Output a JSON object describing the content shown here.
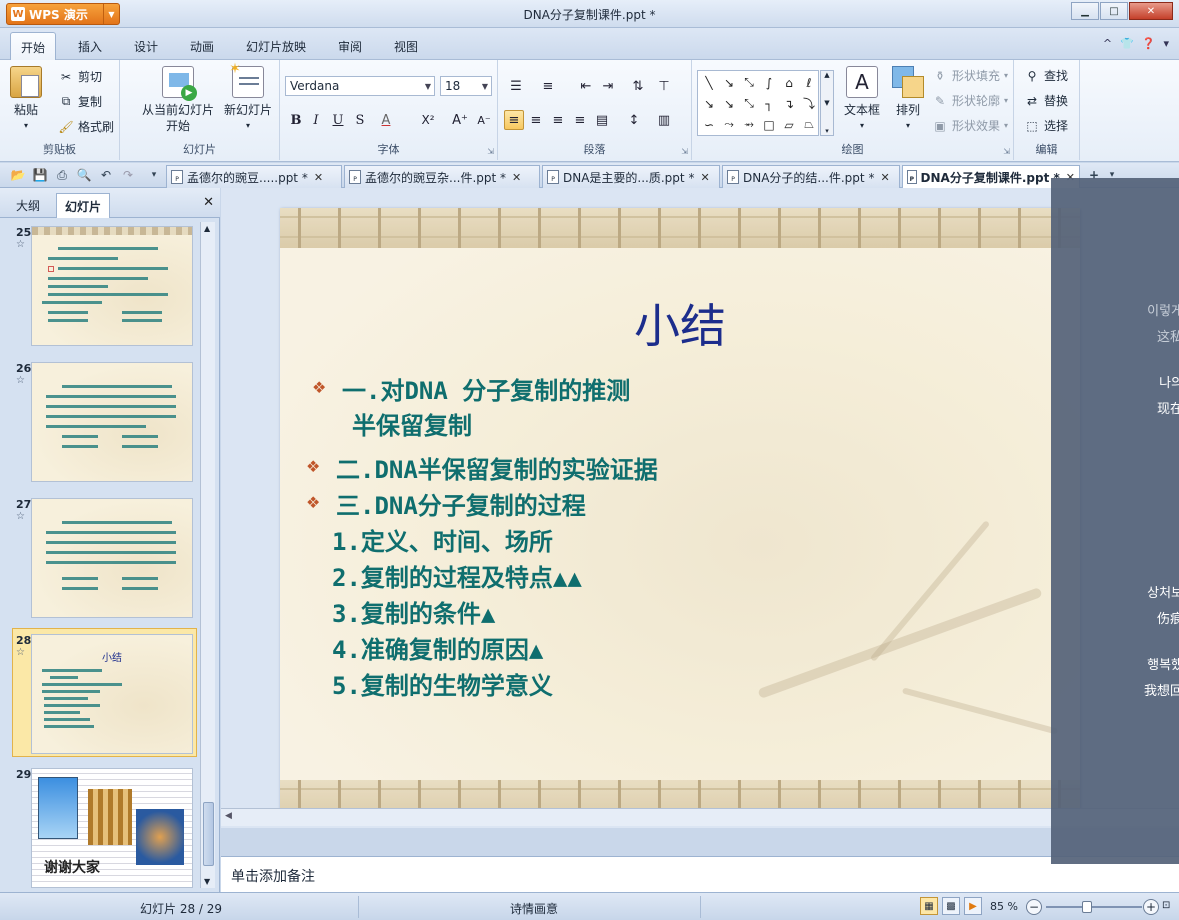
{
  "app": {
    "brand": "WPS 演示",
    "brand_logo": "W",
    "document_title": "DNA分子复制课件.ppt *"
  },
  "window_controls": {
    "minimize": "▁",
    "maximize": "□",
    "close": "✕"
  },
  "menu": {
    "tabs": [
      "开始",
      "插入",
      "设计",
      "动画",
      "幻灯片放映",
      "审阅",
      "视图"
    ],
    "active": "开始",
    "right_icons": [
      "^",
      "shirt-icon",
      "help-icon",
      "▾"
    ]
  },
  "ribbon": {
    "clipboard": {
      "label": "剪贴板",
      "paste": "粘贴",
      "cut": "剪切",
      "copy": "复制",
      "format_painter": "格式刷"
    },
    "slides": {
      "label": "幻灯片",
      "from_current_line1": "从当前幻灯片",
      "from_current_line2": "开始",
      "new_slide": "新幻灯片"
    },
    "font": {
      "label": "字体",
      "font_name": "Verdana",
      "font_size": "18",
      "bold": "B",
      "italic": "I",
      "underline": "U",
      "shadow": "S",
      "font_color": "A",
      "superscript": "X²",
      "grow": "A⁺",
      "shrink": "A⁻"
    },
    "paragraph": {
      "label": "段落"
    },
    "drawing": {
      "label": "绘图",
      "text_box": "文本框",
      "arrange": "排列",
      "shape_fill": "形状填充",
      "shape_outline": "形状轮廓",
      "shape_effect": "形状效果"
    },
    "editing": {
      "label": "编辑",
      "find": "查找",
      "replace": "替换",
      "select": "选择"
    }
  },
  "doc_tabs": [
    {
      "label": "孟德尔的豌豆.....ppt *",
      "active": false
    },
    {
      "label": "孟德尔的豌豆杂...件.ppt *",
      "active": false
    },
    {
      "label": "DNA是主要的...质.ppt *",
      "active": false
    },
    {
      "label": "DNA分子的结...件.ppt *",
      "active": false
    },
    {
      "label": "DNA分子复制课件.ppt *",
      "active": true
    }
  ],
  "left_panel": {
    "tabs": [
      "大纲",
      "幻灯片"
    ],
    "active_tab": "幻灯片",
    "close": "✕",
    "slides": [
      {
        "number": "25",
        "star": "☆",
        "selected": false
      },
      {
        "number": "26",
        "star": "☆",
        "selected": false
      },
      {
        "number": "27",
        "star": "☆",
        "selected": false
      },
      {
        "number": "28",
        "star": "☆",
        "selected": true,
        "title": "小结"
      },
      {
        "number": "29",
        "star": "",
        "selected": false,
        "caption": "谢谢大家"
      }
    ]
  },
  "slide": {
    "title": "小结",
    "bullets": [
      {
        "text": "一.对DNA 分子复制的推测",
        "bullet": true
      },
      {
        "text": "半保留复制",
        "bullet": false
      },
      {
        "text": "二.DNA半保留复制的实验证据",
        "bullet": true
      },
      {
        "text": "三.DNA分子复制的过程",
        "bullet": true
      },
      {
        "text": "1.定义、时间、场所",
        "bullet": false
      },
      {
        "text": "2.复制的过程及特点▲▲",
        "bullet": false
      },
      {
        "text": "3.复制的条件▲",
        "bullet": false
      },
      {
        "text": "4.准确复制的原因▲",
        "bullet": false
      },
      {
        "text": "5.复制的生物学意义",
        "bullet": false
      }
    ]
  },
  "notes": {
    "placeholder": "单击添加备注"
  },
  "overlay_text": [
    "이렇게",
    "这私",
    "나의",
    "现在",
    "I",
    "I",
    "I",
    "상처보",
    "伤痕",
    "행복했",
    "我想回",
    "I",
    "I",
    "I"
  ],
  "status": {
    "slide_counter": "幻灯片 28 / 29",
    "theme": "诗情画意",
    "zoom": "85 %",
    "zoom_level": 0.43
  }
}
